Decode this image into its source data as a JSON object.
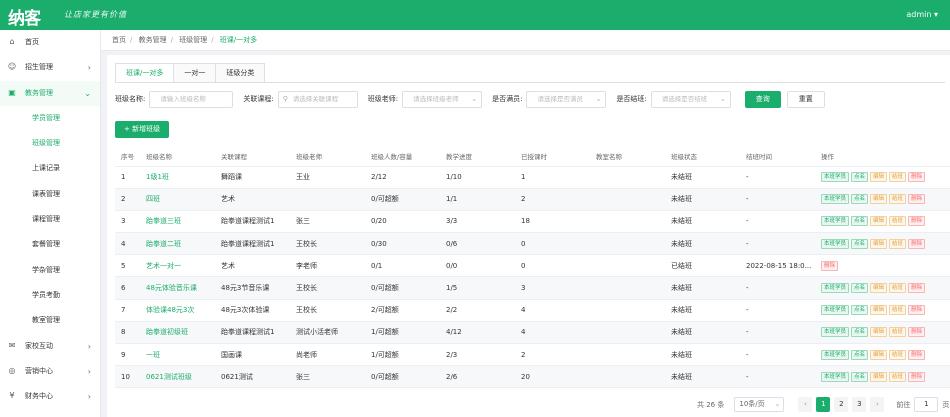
{
  "header": {
    "logo": "纳客",
    "slogan": "让店家更有价值",
    "user": "admin ▾"
  },
  "colors": {
    "accent": "#1aad6b",
    "edit": "#e6a23c",
    "delete": "#f56c6c"
  },
  "sidebar": {
    "items": [
      {
        "label": "首页",
        "icon": "home-icon"
      },
      {
        "label": "招生管理",
        "icon": "user-icon",
        "arrow": "›"
      },
      {
        "label": "教务管理",
        "icon": "book-icon",
        "arrow": "⌄"
      },
      {
        "label": "学员管理"
      },
      {
        "label": "班级管理"
      },
      {
        "label": "上课记录"
      },
      {
        "label": "课表管理"
      },
      {
        "label": "课程管理"
      },
      {
        "label": "套餐管理"
      },
      {
        "label": "学杂管理"
      },
      {
        "label": "学员考勤"
      },
      {
        "label": "教室管理"
      },
      {
        "label": "家校互动",
        "icon": "chat-icon",
        "arrow": "›"
      },
      {
        "label": "营销中心",
        "icon": "marketing-icon",
        "arrow": "›"
      },
      {
        "label": "财务中心",
        "icon": "finance-icon",
        "arrow": "›"
      }
    ]
  },
  "breadcrumb": {
    "items": [
      "首页",
      "教务管理",
      "班级管理",
      "班课/一对多"
    ],
    "sep": "/"
  },
  "tabs": [
    "班课/一对多",
    "一对一",
    "班级分类"
  ],
  "filters": {
    "class_name_label": "班级名称:",
    "class_name_placeholder": "请输入班级名称",
    "course_label": "关联课程:",
    "course_placeholder": "请选择关联课程",
    "teacher_label": "班级老师:",
    "teacher_placeholder": "请选择班级老师",
    "full_label": "是否满员:",
    "full_placeholder": "请选择是否满员",
    "closed_label": "是否结班:",
    "closed_placeholder": "请选择是否结班",
    "search_btn": "查询",
    "reset_btn": "重置"
  },
  "add_button": "+ 新增班级",
  "table": {
    "headers": [
      "序号",
      "班级名称",
      "关联课程",
      "班级老师",
      "班级人数/容量",
      "教学进度",
      "已授课时",
      "教室名称",
      "班级状态",
      "结班时间",
      "操作"
    ],
    "rows": [
      {
        "no": "1",
        "name": "1级1班",
        "course": "舞蹈课",
        "teacher": "王业",
        "cap": "2/12",
        "progress": "1/10",
        "hours": "1",
        "room": "",
        "status": "未结班",
        "end": "-",
        "full": true
      },
      {
        "no": "2",
        "name": "四班",
        "course": "艺术",
        "teacher": "",
        "cap": "0/可超额",
        "progress": "1/1",
        "hours": "2",
        "room": "",
        "status": "未结班",
        "end": "-",
        "full": true
      },
      {
        "no": "3",
        "name": "跆拳道三班",
        "course": "跆拳道课程测试1",
        "teacher": "张三",
        "cap": "0/20",
        "progress": "3/3",
        "hours": "18",
        "room": "",
        "status": "未结班",
        "end": "-",
        "full": true
      },
      {
        "no": "4",
        "name": "跆拳道二班",
        "course": "跆拳道课程测试1",
        "teacher": "王校长",
        "cap": "0/30",
        "progress": "0/6",
        "hours": "0",
        "room": "",
        "status": "未结班",
        "end": "-",
        "full": true
      },
      {
        "no": "5",
        "name": "艺术一对一",
        "course": "艺术",
        "teacher": "李老师",
        "cap": "0/1",
        "progress": "0/0",
        "hours": "0",
        "room": "",
        "status": "已结班",
        "end": "2022-08-15 18:0...",
        "full": false
      },
      {
        "no": "6",
        "name": "48元体验音乐课",
        "course": "48元3节音乐课",
        "teacher": "王校长",
        "cap": "0/可超额",
        "progress": "1/5",
        "hours": "3",
        "room": "",
        "status": "未结班",
        "end": "-",
        "full": true
      },
      {
        "no": "7",
        "name": "体验课48元3次",
        "course": "48元3次体验课",
        "teacher": "王校长",
        "cap": "2/可超额",
        "progress": "2/2",
        "hours": "4",
        "room": "",
        "status": "未结班",
        "end": "-",
        "full": true
      },
      {
        "no": "8",
        "name": "跆拳道初级班",
        "course": "跆拳道课程测试1",
        "teacher": "测试小活老师",
        "cap": "1/可超额",
        "progress": "4/12",
        "hours": "4",
        "room": "",
        "status": "未结班",
        "end": "-",
        "full": true
      },
      {
        "no": "9",
        "name": "一班",
        "course": "国画课",
        "teacher": "尚老师",
        "cap": "1/可超额",
        "progress": "2/3",
        "hours": "2",
        "room": "",
        "status": "未结班",
        "end": "-",
        "full": true
      },
      {
        "no": "10",
        "name": "0621测试班级",
        "course": "0621测试",
        "teacher": "张三",
        "cap": "0/可超额",
        "progress": "2/6",
        "hours": "20",
        "room": "",
        "status": "未结班",
        "end": "-",
        "full": true
      }
    ],
    "actions": {
      "students": "本班学员",
      "rollcall": "点名",
      "edit": "编辑",
      "close": "结班",
      "delete": "删除"
    }
  },
  "pagination": {
    "total": "共 26 条",
    "page_size": "10条/页",
    "pages": [
      "1",
      "2",
      "3"
    ],
    "current": "1",
    "goto_label": "前往",
    "goto_value": "1",
    "goto_suffix": "页"
  }
}
